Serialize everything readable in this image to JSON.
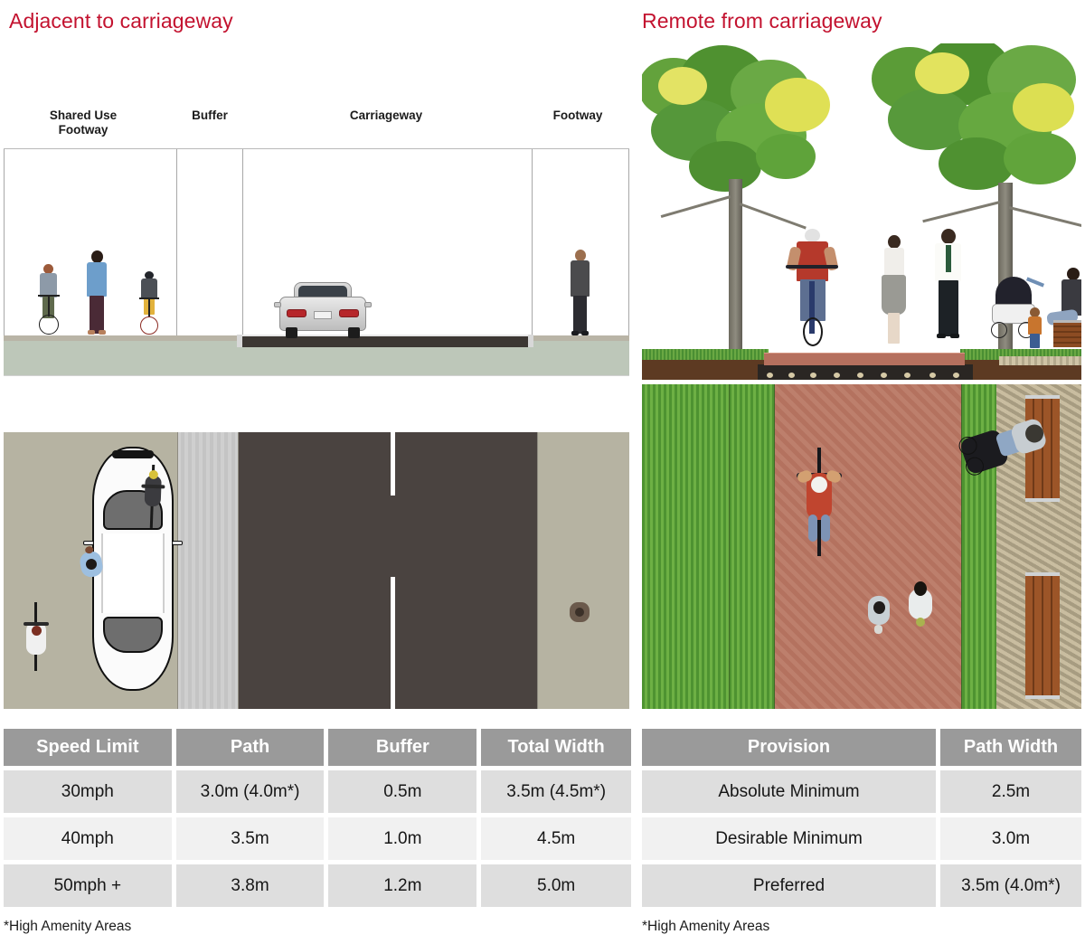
{
  "headings": {
    "left": "Adjacent to carriageway",
    "right": "Remote from carriageway",
    "accent_color": "#c3122f"
  },
  "cross_section": {
    "labels": [
      {
        "name": "shared-use-footway",
        "text": "Shared Use\nFootway"
      },
      {
        "name": "buffer",
        "text": "Buffer"
      },
      {
        "name": "carriageway",
        "text": "Carriageway"
      },
      {
        "name": "footway",
        "text": "Footway"
      }
    ],
    "elements": [
      "cyclist",
      "pedestrian",
      "child-cyclist",
      "car",
      "pedestrian-footway"
    ]
  },
  "plan_left": {
    "zones": [
      "shared use footway",
      "buffer",
      "carriageway",
      "footway"
    ],
    "elements": [
      "cyclist",
      "pedestrian",
      "cyclist",
      "car",
      "pedestrian"
    ]
  },
  "perspective_right": {
    "elements": [
      "tree",
      "tree",
      "cyclist",
      "pedestrian",
      "pedestrian",
      "pram",
      "seated-person",
      "bench"
    ]
  },
  "plan_right": {
    "zones": [
      "grass verge",
      "shared path",
      "grass verge",
      "gravel amenity strip"
    ],
    "elements": [
      "cyclist",
      "pedestrian",
      "pedestrian",
      "wheelchair-user",
      "bench",
      "bench"
    ]
  },
  "table_left": {
    "name": "adjacent-to-carriageway-widths",
    "headers": [
      "Speed Limit",
      "Path",
      "Buffer",
      "Total Width"
    ],
    "rows": [
      [
        "30mph",
        "3.0m (4.0m*)",
        "0.5m",
        "3.5m (4.5m*)"
      ],
      [
        "40mph",
        "3.5m",
        "1.0m",
        "4.5m"
      ],
      [
        "50mph +",
        "3.8m",
        "1.2m",
        "5.0m"
      ]
    ],
    "footnote": "*High Amenity Areas"
  },
  "table_right": {
    "name": "remote-from-carriageway-widths",
    "headers": [
      "Provision",
      "Path Width"
    ],
    "rows": [
      [
        "Absolute Minimum",
        "2.5m"
      ],
      [
        "Desirable Minimum",
        "3.0m"
      ],
      [
        "Preferred",
        "3.5m (4.0m*)"
      ]
    ],
    "footnote": "*High Amenity Areas"
  },
  "palette": {
    "header_gray": "#9a9a9a",
    "row_dark": "#dedede",
    "row_light": "#f1f1f1",
    "ground_green": "#bdc7b9",
    "asphalt": "#4a4340",
    "verge_tan": "#b6b3a2",
    "grass_green": "#5aa03a",
    "path_terracotta": "#b5705e"
  }
}
